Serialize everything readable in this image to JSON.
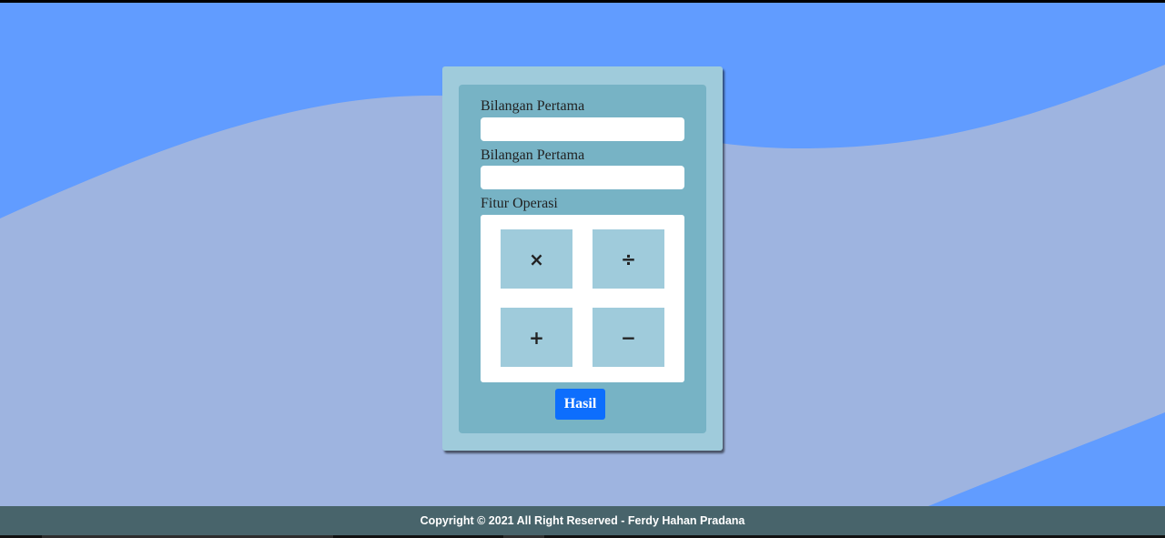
{
  "form": {
    "first_label": "Bilangan Pertama",
    "first_value": "",
    "second_label": "Bilangan Pertama",
    "second_value": "",
    "operations_label": "Fitur Operasi",
    "operations": {
      "multiply": "×",
      "divide": "÷",
      "add": "+",
      "subtract": "−"
    },
    "result_button": "Hasil"
  },
  "footer": {
    "copyright": "Copyright © 2021 All Right Reserved - Ferdy Hahan Pradana"
  },
  "colors": {
    "background_blue": "#619cff",
    "wave": "#9eb4e0",
    "card_outer": "#9fcbdb",
    "card_inner": "#77b3c5",
    "button": "#0d6efd",
    "footer": "#48646b"
  }
}
